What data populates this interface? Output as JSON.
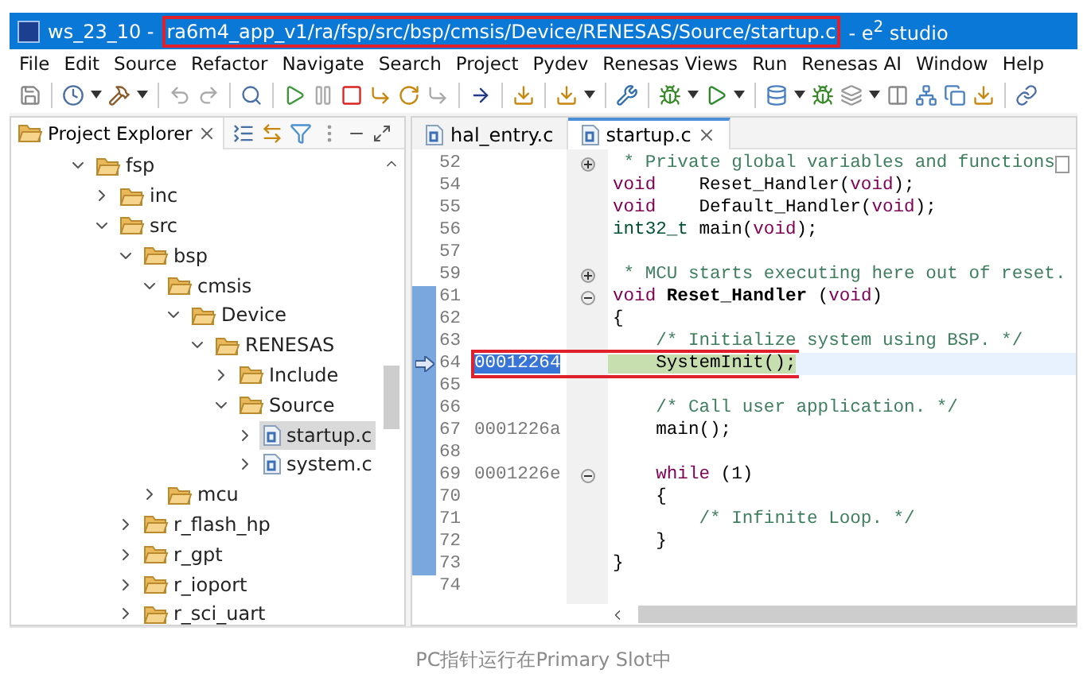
{
  "window": {
    "title_prefix": "ws_23_10 -",
    "title_path": "ra6m4_app_v1/ra/fsp/src/bsp/cmsis/Device/RENESAS/Source/startup.c",
    "title_path_annotated": true,
    "title_suffix": "- e$^{2}$ studio"
  },
  "menu": [
    "File",
    "Edit",
    "Source",
    "Refactor",
    "Navigate",
    "Search",
    "Project",
    "Pydev",
    "Renesas Views",
    "Run",
    "Renesas AI",
    "Window",
    "Help"
  ],
  "explorer": {
    "tab": "Project Explorer",
    "tree": [
      {
        "label": "fsp",
        "kind": "folder",
        "expanded": true,
        "selected": false,
        "children": [
          {
            "label": "inc",
            "kind": "folder",
            "expanded": false,
            "selected": false
          },
          {
            "label": "src",
            "kind": "folder",
            "expanded": true,
            "selected": false,
            "children": [
              {
                "label": "bsp",
                "kind": "folder",
                "expanded": true,
                "selected": false,
                "children": [
                  {
                    "label": "cmsis",
                    "kind": "folder",
                    "expanded": true,
                    "selected": false,
                    "children": [
                      {
                        "label": "Device",
                        "kind": "folder",
                        "expanded": true,
                        "selected": false,
                        "children": [
                          {
                            "label": "RENESAS",
                            "kind": "folder",
                            "expanded": true,
                            "selected": false,
                            "children": [
                              {
                                "label": "Include",
                                "kind": "folder",
                                "expanded": false,
                                "selected": false
                              },
                              {
                                "label": "Source",
                                "kind": "folder",
                                "expanded": true,
                                "selected": false,
                                "children": [
                                  {
                                    "label": "startup.c",
                                    "kind": "file",
                                    "expanded": false,
                                    "selected": true
                                  },
                                  {
                                    "label": "system.c",
                                    "kind": "file",
                                    "expanded": false,
                                    "selected": false
                                  }
                                ]
                              }
                            ]
                          }
                        ]
                      }
                    ]
                  },
                  {
                    "label": "mcu",
                    "kind": "folder",
                    "expanded": false,
                    "selected": false
                  }
                ]
              },
              {
                "label": "r_flash_hp",
                "kind": "folder",
                "expanded": false,
                "selected": false
              },
              {
                "label": "r_gpt",
                "kind": "folder",
                "expanded": false,
                "selected": false
              },
              {
                "label": "r_ioport",
                "kind": "folder",
                "expanded": false,
                "selected": false
              },
              {
                "label": "r_sci_uart",
                "kind": "folder",
                "expanded": false,
                "selected": false
              }
            ]
          }
        ]
      }
    ]
  },
  "editor": {
    "tabs": [
      {
        "label": "hal_entry.c",
        "selected": false
      },
      {
        "label": "startup.c",
        "selected": true
      }
    ],
    "lines": [
      {
        "number": "52",
        "fold_control": true,
        "folded": true,
        "in_range": false,
        "current": false,
        "annotated": false,
        "segments": [
          {
            "text": " * Private global variables and functions",
            "kind": "comment"
          }
        ],
        "collapsed_marker": true
      },
      {
        "number": "54",
        "fold_control": false,
        "in_range": false,
        "current": false,
        "annotated": false,
        "segments": [
          {
            "text": "void",
            "kind": "keyword"
          },
          {
            "text": "    Reset_Handler(",
            "kind": "plain"
          },
          {
            "text": "void",
            "kind": "keyword"
          },
          {
            "text": ");",
            "kind": "plain"
          }
        ]
      },
      {
        "number": "55",
        "fold_control": false,
        "in_range": false,
        "current": false,
        "annotated": false,
        "segments": [
          {
            "text": "void",
            "kind": "keyword"
          },
          {
            "text": "    Default_Handler(",
            "kind": "plain"
          },
          {
            "text": "void",
            "kind": "keyword"
          },
          {
            "text": ");",
            "kind": "plain"
          }
        ]
      },
      {
        "number": "56",
        "fold_control": false,
        "in_range": false,
        "current": false,
        "annotated": false,
        "segments": [
          {
            "text": "int32_t",
            "kind": "type"
          },
          {
            "text": " main(",
            "kind": "plain"
          },
          {
            "text": "void",
            "kind": "keyword"
          },
          {
            "text": ");",
            "kind": "plain"
          }
        ]
      },
      {
        "number": "57",
        "fold_control": false,
        "in_range": false,
        "current": false,
        "annotated": false
      },
      {
        "number": "59",
        "fold_control": true,
        "folded": true,
        "in_range": false,
        "current": false,
        "annotated": false,
        "segments": [
          {
            "text": " * MCU starts executing here out of reset.",
            "kind": "comment"
          }
        ]
      },
      {
        "number": "61",
        "fold_control": true,
        "folded": false,
        "in_range": true,
        "current": false,
        "annotated": false,
        "segments": [
          {
            "text": "void",
            "kind": "keyword"
          },
          {
            "text": " Reset_Handler",
            "kind": "bold"
          },
          {
            "text": " (",
            "kind": "plain"
          },
          {
            "text": "void",
            "kind": "keyword"
          },
          {
            "text": ")",
            "kind": "plain"
          }
        ]
      },
      {
        "number": "62",
        "fold_control": false,
        "in_range": true,
        "current": false,
        "annotated": false,
        "segments": [
          {
            "text": "{",
            "kind": "plain"
          }
        ]
      },
      {
        "number": "63",
        "fold_control": false,
        "in_range": true,
        "current": false,
        "annotated": false,
        "segments": [
          {
            "text": "    /* Initialize system using BSP. */",
            "kind": "comment"
          }
        ]
      },
      {
        "number": "64",
        "fold_control": false,
        "address": {
          "text": "00012264",
          "selected": true
        },
        "in_range": true,
        "current": true,
        "annotated": true,
        "segments": [
          {
            "text": "    SystemInit();",
            "kind": "plain"
          }
        ]
      },
      {
        "number": "65",
        "fold_control": false,
        "in_range": true,
        "current": false,
        "annotated": false
      },
      {
        "number": "66",
        "fold_control": false,
        "in_range": true,
        "current": false,
        "annotated": false,
        "segments": [
          {
            "text": "    /* Call user application. */",
            "kind": "comment"
          }
        ]
      },
      {
        "number": "67",
        "fold_control": false,
        "address": {
          "text": "0001226a",
          "selected": false
        },
        "in_range": true,
        "current": false,
        "annotated": false,
        "segments": [
          {
            "text": "    main();",
            "kind": "plain"
          }
        ]
      },
      {
        "number": "68",
        "fold_control": false,
        "in_range": true,
        "current": false,
        "annotated": false
      },
      {
        "number": "69",
        "address": {
          "text": "0001226e",
          "selected": false
        },
        "fold_control": true,
        "folded": false,
        "in_range": true,
        "current": false,
        "annotated": false,
        "segments": [
          {
            "text": "    while",
            "kind": "keyword"
          },
          {
            "text": " (1)",
            "kind": "plain"
          }
        ]
      },
      {
        "number": "70",
        "fold_control": false,
        "in_range": true,
        "current": false,
        "annotated": false,
        "segments": [
          {
            "text": "    {",
            "kind": "plain"
          }
        ]
      },
      {
        "number": "71",
        "fold_control": false,
        "in_range": true,
        "current": false,
        "annotated": false,
        "segments": [
          {
            "text": "        /* Infinite Loop. */",
            "kind": "comment"
          }
        ]
      },
      {
        "number": "72",
        "fold_control": false,
        "in_range": true,
        "current": false,
        "annotated": false,
        "segments": [
          {
            "text": "    }",
            "kind": "plain"
          }
        ]
      },
      {
        "number": "73",
        "fold_control": false,
        "in_range": true,
        "current": false,
        "annotated": false,
        "segments": [
          {
            "text": "}",
            "kind": "plain"
          }
        ]
      },
      {
        "number": "74",
        "fold_control": false,
        "in_range": false,
        "current": false,
        "annotated": false
      }
    ]
  },
  "caption": "PC指针运行在Primary Slot中"
}
